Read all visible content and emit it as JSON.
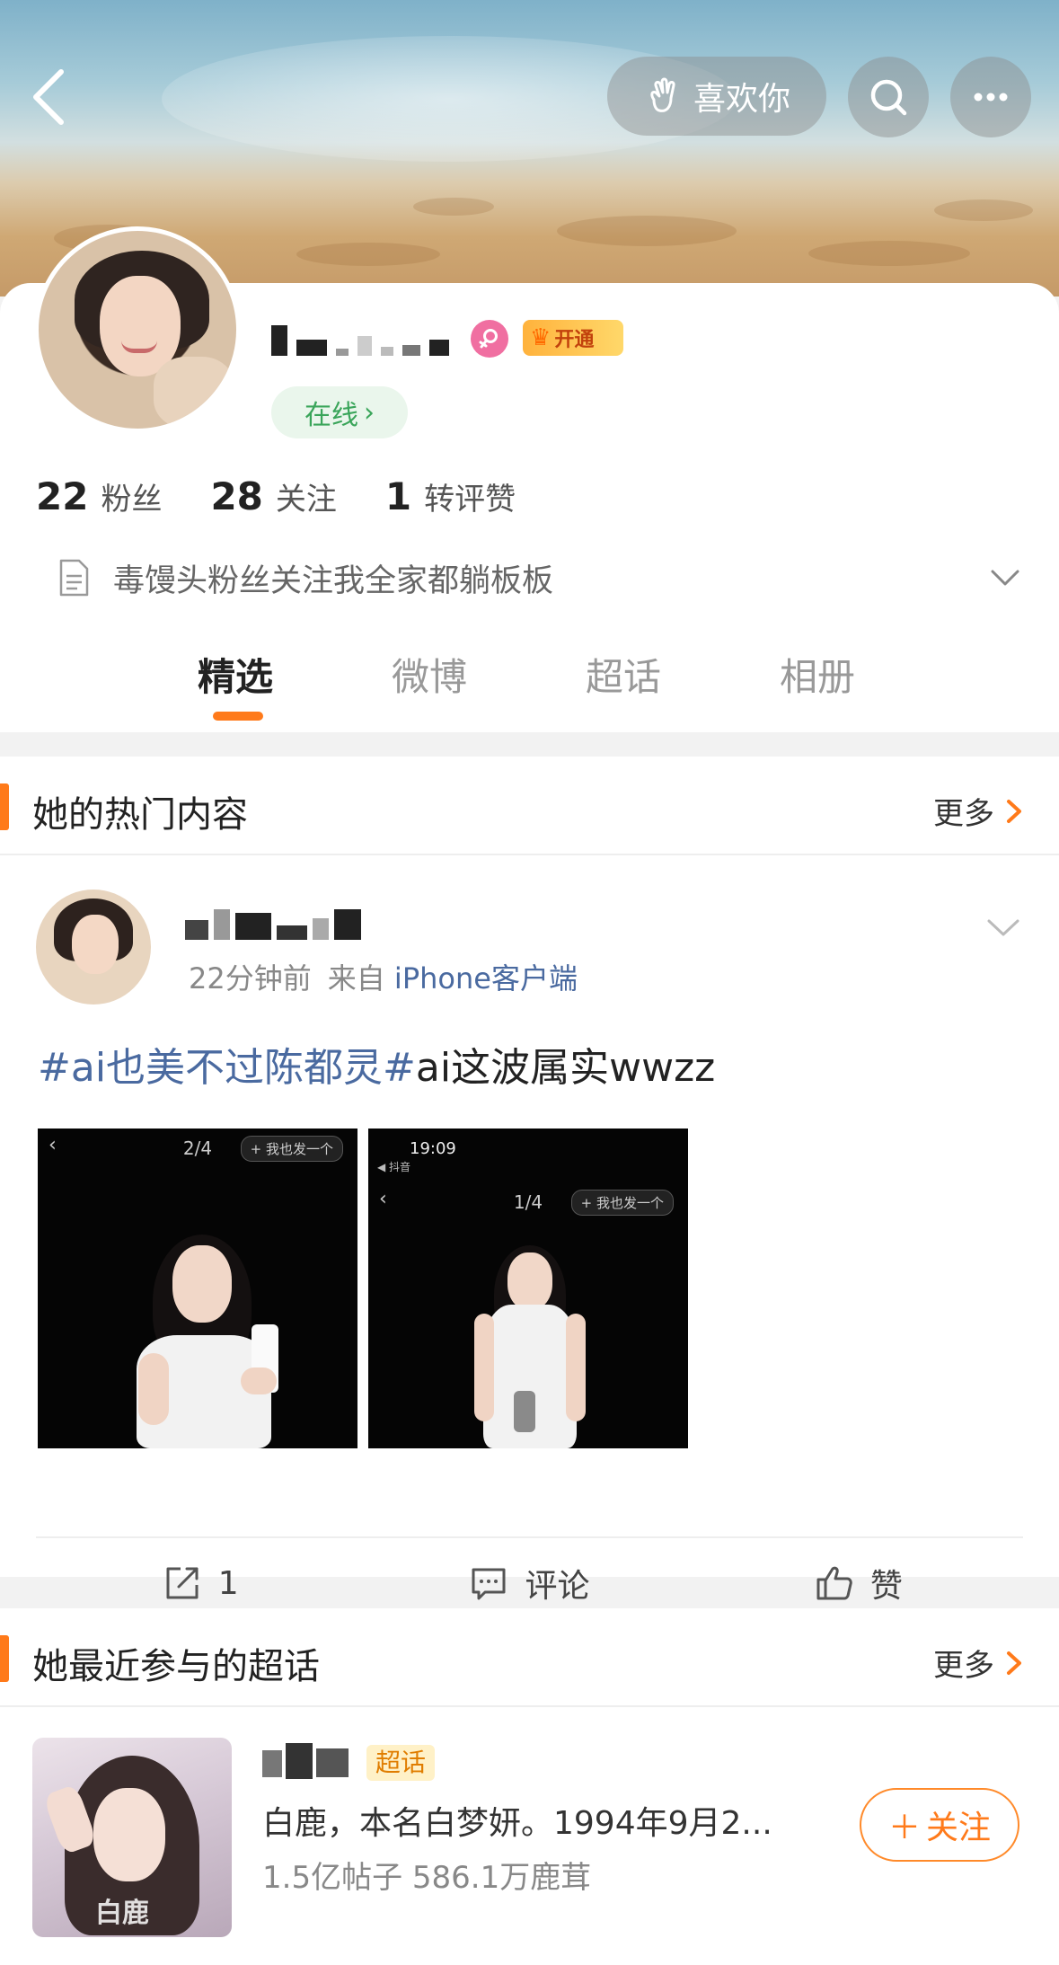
{
  "header": {
    "like_button_label": "喜欢你"
  },
  "profile": {
    "vip_badge_label": "开通",
    "online_label": "在线",
    "stats": [
      {
        "num": "22",
        "label": "粉丝"
      },
      {
        "num": "28",
        "label": "关注"
      },
      {
        "num": "1",
        "label": "转评赞"
      }
    ],
    "bio": "毒馒头粉丝关注我全家都躺板板"
  },
  "tabs": [
    {
      "label": "精选",
      "active": true
    },
    {
      "label": "微博",
      "active": false
    },
    {
      "label": "超话",
      "active": false
    },
    {
      "label": "相册",
      "active": false
    }
  ],
  "hot_section": {
    "title": "她的热门内容",
    "more_label": "更多"
  },
  "post": {
    "time": "22分钟前",
    "source_prefix": "来自",
    "source_client": "iPhone客户端",
    "hashtag": "#ai也美不过陈都灵#",
    "text": "ai这波属实wwzz",
    "images": [
      {
        "page_index": "2/4",
        "add_label": "+ 我也发一个"
      },
      {
        "page_index": "1/4",
        "add_label": "+ 我也发一个",
        "status_time": "19:09",
        "status_app": "◀ 抖音"
      }
    ],
    "actions": {
      "repost_count": "1",
      "comment_label": "评论",
      "like_label": "赞"
    }
  },
  "topic_section": {
    "title": "她最近参与的超话",
    "more_label": "更多",
    "topic": {
      "badge": "超话",
      "description": "白鹿，本名白梦妍。1994年9月2...",
      "stats": "1.5亿帖子 586.1万鹿茸",
      "image_watermark": "白鹿",
      "follow_label": "关注"
    }
  },
  "colors": {
    "accent": "#ff7a1a",
    "link": "#4a6aa0",
    "online_green": "#3aa55a"
  }
}
